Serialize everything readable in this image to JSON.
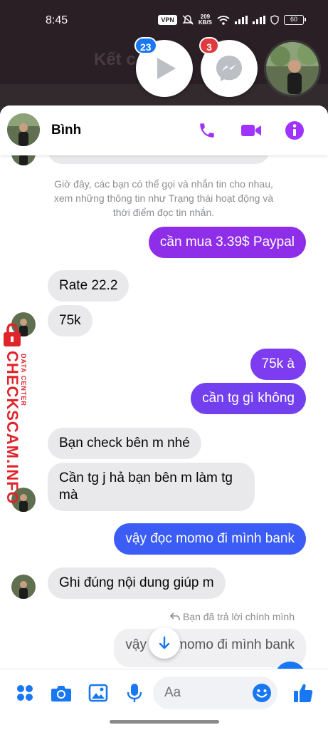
{
  "status_bar": {
    "time": "8:45",
    "vpn": "VPN",
    "speed_value": "209",
    "speed_unit": "KB/S",
    "battery": "60"
  },
  "background_app": {
    "title": "Kết c"
  },
  "chat_heads": [
    {
      "badge": "23",
      "badge_color": "#1877f2",
      "icon": "play-icon"
    },
    {
      "badge": "3",
      "badge_color": "#e0393e",
      "icon": "messenger-icon"
    }
  ],
  "header": {
    "name": "Bình",
    "accent": "#a033ff",
    "actions": [
      "phone-icon",
      "video-icon",
      "info-icon"
    ]
  },
  "system_note": "Giờ đây, các bạn có thể gọi và nhắn tin cho nhau, xem những thông tin như Trạng thái hoạt động và thời điểm đọc tin nhắn.",
  "messages": [
    {
      "dir": "out",
      "text": "cần mua 3.39$ Paypal",
      "color": "#8e2ee8"
    },
    {
      "dir": "in",
      "text": "Rate 22.2"
    },
    {
      "dir": "in",
      "text": "75k"
    },
    {
      "dir": "out",
      "text": "75k à",
      "color": "#7d3cf0"
    },
    {
      "dir": "out",
      "text": "cần tg gì không",
      "color": "#7340f0"
    },
    {
      "dir": "in",
      "text": "Bạn check bên m nhé"
    },
    {
      "dir": "in",
      "text": "Cần tg j hả bạn bên m làm tg\nmà"
    },
    {
      "dir": "out",
      "text": "vậy đọc momo đi mình bank",
      "color": "#3b5df5"
    },
    {
      "dir": "in",
      "text": "Ghi đúng nội dung giúp m"
    }
  ],
  "reply": {
    "note": "Bạn đã trả lời chính mình",
    "quoted": "vậy đọc momo đi mình bank"
  },
  "composer": {
    "placeholder": "Aa",
    "accent": "#1877f2",
    "icons": [
      "menu-dots-icon",
      "camera-icon",
      "image-icon",
      "mic-icon",
      "emoji-icon",
      "like-icon"
    ]
  },
  "watermark": {
    "brand": "CHECKSCAM.INFO",
    "sub": "DATA CENTER"
  }
}
